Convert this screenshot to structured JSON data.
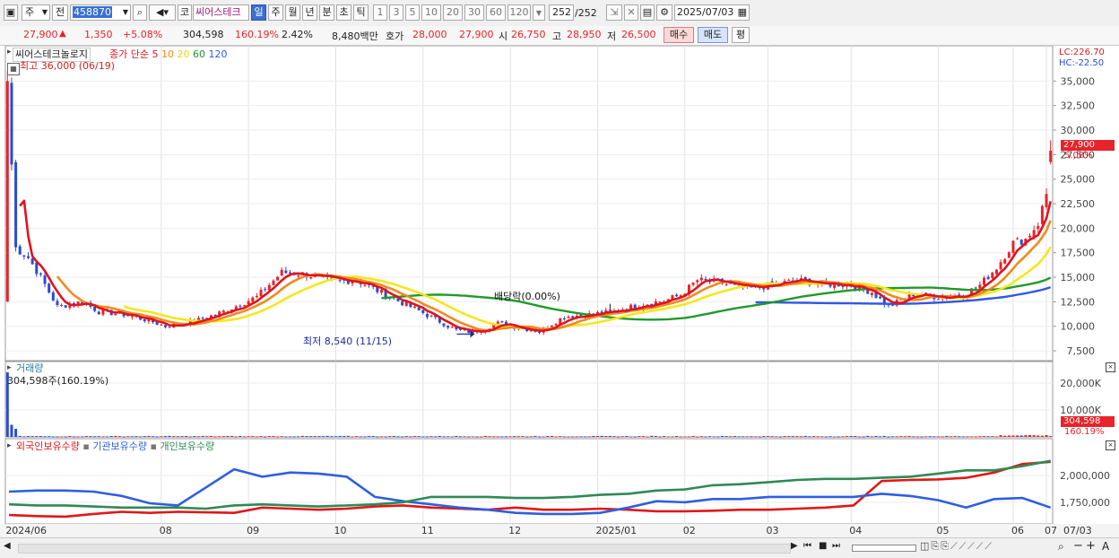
{
  "toolbar": {
    "market": "주",
    "prev_label": "전",
    "code": "458870",
    "code_type": "코",
    "stock_name": "씨어스테크",
    "periods": [
      "일",
      "주",
      "월",
      "년",
      "분",
      "초",
      "틱"
    ],
    "active_period": "일",
    "intervals": [
      "1",
      "3",
      "5",
      "10",
      "20",
      "30",
      "60",
      "120"
    ],
    "count": "252",
    "count_total": "/252",
    "date": "2025/07/03"
  },
  "info": {
    "price": "27,900",
    "change": "1,350",
    "change_pct": "+5.08%",
    "volume": "304,598",
    "volume_ratio": "160.19%",
    "turnover": "2.42%",
    "amount": "8,480백만",
    "ask_label": "호가",
    "ask": "28,000",
    "bid": "27,900",
    "open_label": "시",
    "open": "26,750",
    "high_label": "고",
    "high": "28,950",
    "low_label": "저",
    "low": "26,500",
    "buy_label": "매수",
    "sell_label": "매도",
    "eval_label": "평"
  },
  "colors": {
    "up": "#e8232a",
    "down": "#2a4bd6",
    "ma5": "#e0141e",
    "ma10": "#f08a1e",
    "ma20": "#f5e61e",
    "ma60": "#1e9a2a",
    "ma120": "#3058e0",
    "foreign": "#e01818",
    "institution": "#2e5fe0",
    "individual": "#2e8a55"
  },
  "chart_data": [
    {
      "type": "candlestick",
      "title": "씨어스테크놀로지",
      "legend_prefix": "종가 단순",
      "ma_periods": [
        "5",
        "10",
        "20",
        "60",
        "120"
      ],
      "ylim": [
        6500,
        37500
      ],
      "y_ticks": [
        "7,500",
        "10,000",
        "12,500",
        "15,000",
        "17,500",
        "20,000",
        "22,500",
        "25,000",
        "27,500",
        "30,000",
        "32,500",
        "35,000"
      ],
      "lc_label": "LC:226.70",
      "hc_label": "HC:-22.50",
      "last_label": "27,900",
      "last_pct": "5.08%",
      "high_annotation": "최고 36,000 (06/19)",
      "low_annotation": "최저 8,540 (11/15)",
      "dividend_annotation": "배당락(0.00%)",
      "ohlc_anchors": [
        {
          "x": 0,
          "c": 35000,
          "h": 36000,
          "l": 12500
        },
        {
          "x": 2,
          "c": 18000
        },
        {
          "x": 5,
          "c": 17000
        },
        {
          "x": 8,
          "c": 15000
        },
        {
          "x": 12,
          "c": 12000
        },
        {
          "x": 18,
          "c": 12500
        },
        {
          "x": 22,
          "c": 11500
        },
        {
          "x": 28,
          "c": 11200
        },
        {
          "x": 34,
          "c": 10600
        },
        {
          "x": 38,
          "c": 10000
        },
        {
          "x": 45,
          "c": 10500
        },
        {
          "x": 52,
          "c": 11500
        },
        {
          "x": 60,
          "c": 13000
        },
        {
          "x": 66,
          "c": 15500
        },
        {
          "x": 72,
          "c": 15300
        },
        {
          "x": 78,
          "c": 14600
        },
        {
          "x": 84,
          "c": 14700
        },
        {
          "x": 92,
          "c": 13000
        },
        {
          "x": 98,
          "c": 11800
        },
        {
          "x": 104,
          "c": 10500
        },
        {
          "x": 108,
          "c": 9600
        },
        {
          "x": 112,
          "c": 9400
        },
        {
          "x": 118,
          "c": 10300
        },
        {
          "x": 124,
          "c": 9800
        },
        {
          "x": 128,
          "c": 9500
        },
        {
          "x": 134,
          "c": 11000
        },
        {
          "x": 140,
          "c": 11200
        },
        {
          "x": 146,
          "c": 11500
        },
        {
          "x": 152,
          "c": 12200
        },
        {
          "x": 158,
          "c": 12600
        },
        {
          "x": 162,
          "c": 13200
        },
        {
          "x": 166,
          "c": 14700
        },
        {
          "x": 172,
          "c": 14400
        },
        {
          "x": 178,
          "c": 13800
        },
        {
          "x": 184,
          "c": 14200
        },
        {
          "x": 190,
          "c": 14700
        },
        {
          "x": 196,
          "c": 14300
        },
        {
          "x": 202,
          "c": 14300
        },
        {
          "x": 208,
          "c": 13500
        },
        {
          "x": 212,
          "c": 12000
        },
        {
          "x": 218,
          "c": 13300
        },
        {
          "x": 224,
          "c": 13000
        },
        {
          "x": 230,
          "c": 13200
        },
        {
          "x": 234,
          "c": 14200
        },
        {
          "x": 238,
          "c": 16000
        },
        {
          "x": 242,
          "c": 18500
        },
        {
          "x": 245,
          "c": 18900
        },
        {
          "x": 248,
          "c": 20500
        },
        {
          "x": 250,
          "c": 23500
        },
        {
          "x": 251,
          "c": 27900,
          "o": 26750,
          "h": 28950,
          "l": 26500
        }
      ],
      "ma60_start_price": 12400,
      "ma120_start_price": 11800
    },
    {
      "type": "bar",
      "title": "거래량",
      "label": "304,598주(160.19%)",
      "y_ticks": [
        "20,000K",
        "10,000K"
      ],
      "ylim": [
        0,
        26000000
      ],
      "last_label": "304,598",
      "last_pct": "160.19%"
    },
    {
      "type": "line",
      "series": [
        {
          "name": "외국인보유수량",
          "key": "foreign",
          "values": [
            1630000,
            1620000,
            1615000,
            1640000,
            1660000,
            1650000,
            1660000,
            1655000,
            1650000,
            1700000,
            1690000,
            1680000,
            1690000,
            1710000,
            1720000,
            1700000,
            1690000,
            1680000,
            1700000,
            1680000,
            1680000,
            1690000,
            1680000,
            1665000,
            1665000,
            1670000,
            1680000,
            1680000,
            1690000,
            1700000,
            1720000,
            1950000,
            1960000,
            1965000,
            1980000,
            2030000,
            2110000,
            2130000
          ]
        },
        {
          "name": "기관보유수량",
          "key": "institution",
          "values": [
            1850000,
            1860000,
            1860000,
            1850000,
            1810000,
            1740000,
            1720000,
            1890000,
            2060000,
            1990000,
            2030000,
            2020000,
            1990000,
            1800000,
            1760000,
            1730000,
            1700000,
            1680000,
            1650000,
            1640000,
            1640000,
            1650000,
            1700000,
            1760000,
            1750000,
            1780000,
            1780000,
            1800000,
            1800000,
            1800000,
            1800000,
            1830000,
            1810000,
            1770000,
            1700000,
            1780000,
            1790000,
            1700000
          ]
        },
        {
          "name": "개인보유수량",
          "key": "individual",
          "values": [
            1730000,
            1720000,
            1720000,
            1710000,
            1700000,
            1700000,
            1700000,
            1690000,
            1720000,
            1730000,
            1720000,
            1710000,
            1720000,
            1730000,
            1750000,
            1800000,
            1800000,
            1800000,
            1790000,
            1790000,
            1800000,
            1820000,
            1830000,
            1860000,
            1870000,
            1910000,
            1920000,
            1940000,
            1960000,
            1970000,
            1970000,
            1980000,
            1990000,
            2020000,
            2050000,
            2050000,
            2090000,
            2140000
          ]
        }
      ],
      "ylim": [
        1580000,
        2230000
      ],
      "y_ticks": [
        "2,000,000",
        "1,750,000"
      ]
    }
  ],
  "x_axis": {
    "labels": [
      "2024/06",
      "08",
      "09",
      "10",
      "11",
      "12",
      "2025/01",
      "02",
      "03",
      "04",
      "05",
      "06",
      "07"
    ],
    "right_label": "07/03"
  }
}
